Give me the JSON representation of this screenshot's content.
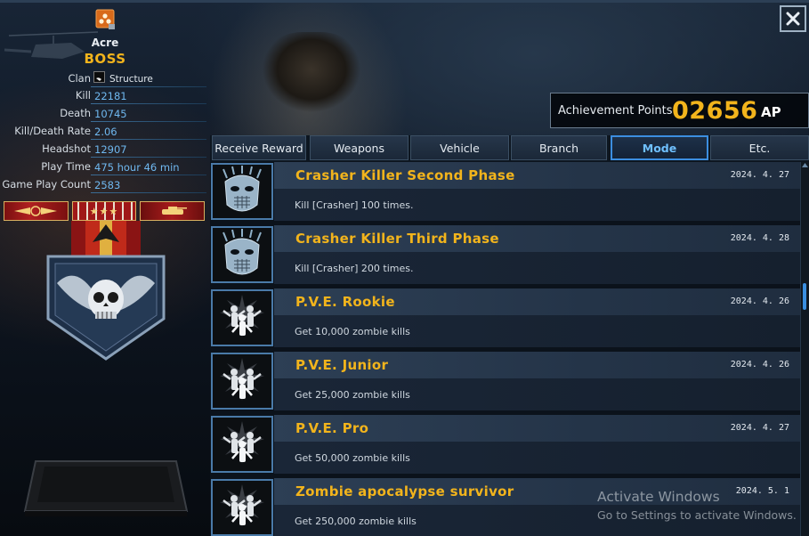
{
  "profile": {
    "name": "Acre",
    "title": "BOSS",
    "clan_label": "Clan",
    "clan_name": "Structure",
    "stats": [
      {
        "label": "Kill",
        "value": "22181"
      },
      {
        "label": "Death",
        "value": "10745"
      },
      {
        "label": "Kill/Death Rate",
        "value": "2.06"
      },
      {
        "label": "Headshot",
        "value": "12907"
      },
      {
        "label": "Play Time",
        "value": "475 hour 46 min"
      },
      {
        "label": "Game Play Count",
        "value": "2583"
      }
    ],
    "ribbon_stars": "★★★"
  },
  "achievement_points": {
    "label": "Achievement Points",
    "value": "02656",
    "unit": "AP"
  },
  "tabs": [
    {
      "label": "Receive Reward",
      "active": false
    },
    {
      "label": "Weapons",
      "active": false
    },
    {
      "label": "Vehicle",
      "active": false
    },
    {
      "label": "Branch",
      "active": false
    },
    {
      "label": "Mode",
      "active": true
    },
    {
      "label": "Etc.",
      "active": false
    }
  ],
  "achievements": [
    {
      "title": "Crasher Killer Second Phase",
      "date": "2024. 4. 27",
      "desc": "Kill [Crasher] 100 times.",
      "icon": "crasher-mask-icon"
    },
    {
      "title": "Crasher Killer Third Phase",
      "date": "2024. 4. 28",
      "desc": "Kill [Crasher] 200 times.",
      "icon": "crasher-mask-icon"
    },
    {
      "title": "P.V.E. Rookie",
      "date": "2024. 4. 26",
      "desc": "Get 10,000 zombie kills",
      "icon": "zombie-horde-icon"
    },
    {
      "title": "P.V.E. Junior",
      "date": "2024. 4. 26",
      "desc": "Get 25,000 zombie kills",
      "icon": "zombie-horde-icon"
    },
    {
      "title": "P.V.E. Pro",
      "date": "2024. 4. 27",
      "desc": "Get 50,000 zombie kills",
      "icon": "zombie-horde-icon"
    },
    {
      "title": "Zombie apocalypse survivor",
      "date": "2024. 5. 1",
      "desc": "Get 250,000 zombie kills",
      "icon": "zombie-horde-icon"
    }
  ],
  "watermark": {
    "line1": "Activate Windows",
    "line2": "Go to Settings to activate Windows."
  },
  "colors": {
    "accent_gold": "#f2b41c",
    "accent_blue": "#3c8ee0",
    "stat_value": "#6fb8f0"
  }
}
